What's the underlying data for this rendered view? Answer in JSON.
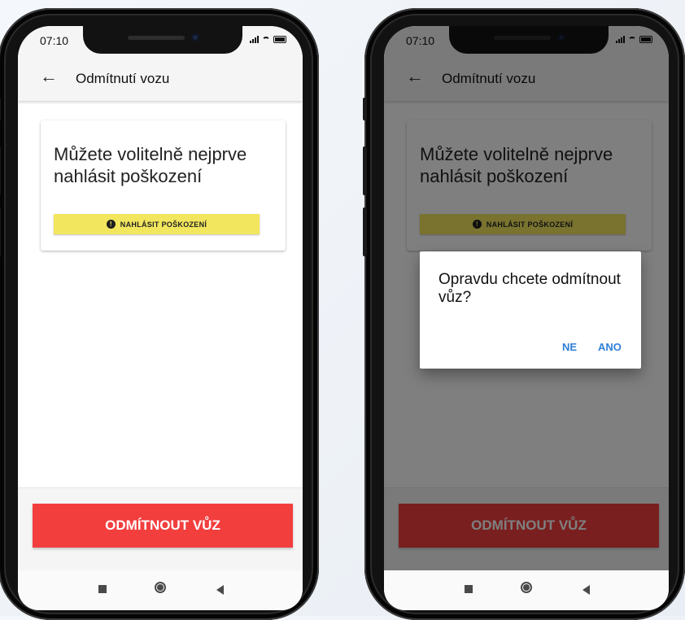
{
  "status": {
    "time": "07:10"
  },
  "appbar": {
    "title": "Odmítnutí vozu"
  },
  "card": {
    "text": "Můžete volitelně nejprve nahlásit poškození",
    "report_button": "NAHLÁSIT POŠKOZENÍ"
  },
  "footer": {
    "reject_button": "ODMÍTNOUT VŮZ"
  },
  "dialog": {
    "title": "Opravdu chcete odmítnout vůz?",
    "no": "NE",
    "yes": "ANO"
  },
  "colors": {
    "reject": "#f33e3e",
    "report": "#f2e65e",
    "dialog_button": "#2f7fd8"
  }
}
